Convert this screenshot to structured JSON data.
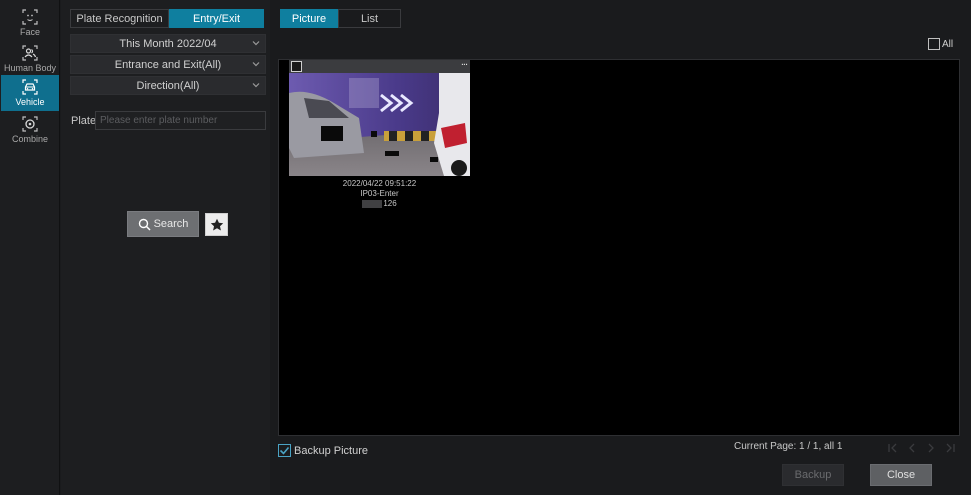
{
  "sidebar": {
    "items": [
      {
        "label": "Face",
        "icon": "face-icon",
        "active": false
      },
      {
        "label": "Human Body",
        "icon": "human-body-icon",
        "active": false
      },
      {
        "label": "Vehicle",
        "icon": "vehicle-icon",
        "active": true
      },
      {
        "label": "Combine",
        "icon": "combine-icon",
        "active": false
      }
    ]
  },
  "mode_tabs": [
    {
      "label": "Plate Recognition",
      "active": false
    },
    {
      "label": "Entry/Exit",
      "active": true
    }
  ],
  "filters": {
    "time": "This Month 2022/04",
    "entrance": "Entrance and Exit(All)",
    "direction": "Direction(All)"
  },
  "plate": {
    "label": "Plate",
    "placeholder": "Please enter plate number",
    "value": ""
  },
  "search": {
    "label": "Search"
  },
  "view_tabs": [
    {
      "label": "Picture",
      "active": true
    },
    {
      "label": "List",
      "active": false
    }
  ],
  "select_all": {
    "label": "All",
    "checked": false
  },
  "results": [
    {
      "timestamp": "2022/04/22 09:51:22",
      "channel": "IP03-Enter",
      "plate_suffix": "126",
      "more": "..."
    }
  ],
  "backup_picture": {
    "label": "Backup Picture",
    "checked": true
  },
  "pagination": {
    "text": "Current Page: 1 / 1, all 1"
  },
  "actions": {
    "backup": "Backup",
    "close": "Close"
  },
  "colors": {
    "accent": "#0f7f9f",
    "background": "#1a1b1d",
    "results_bg": "#000000"
  }
}
